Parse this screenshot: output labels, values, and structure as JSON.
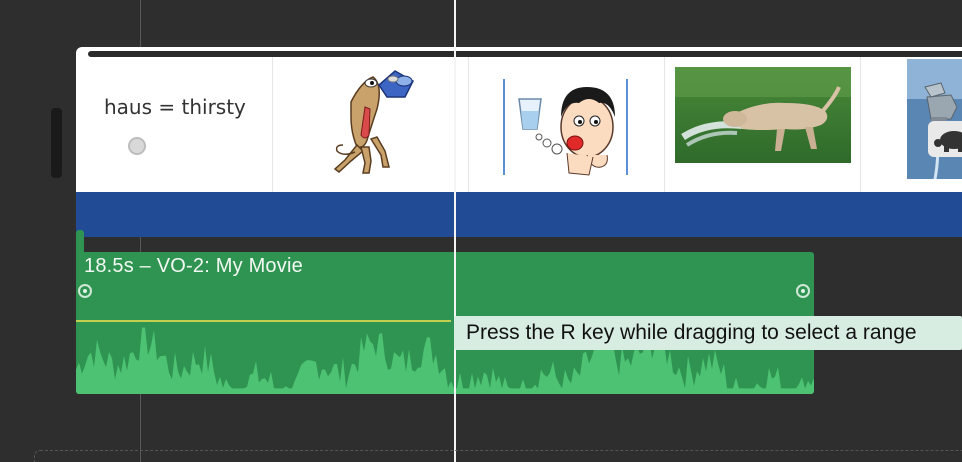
{
  "video_clip": {
    "title_card_text": "haus = thirsty",
    "frames": [
      {
        "image": "title-card"
      },
      {
        "image": "cartoon-dog-drinking-icon"
      },
      {
        "image": "cartoon-boy-thirsty-icon"
      },
      {
        "image": "dog-drinking-sprinkler-photo"
      },
      {
        "image": "water-faucet-photo"
      }
    ],
    "band_color": "#224b96",
    "speed_badge_icon": "turtle-icon"
  },
  "audio_clip": {
    "title": "18.5s – VO-2: My Movie",
    "color": "#2f9451"
  },
  "tooltip": {
    "text": "Press the R key while dragging to select a range"
  }
}
